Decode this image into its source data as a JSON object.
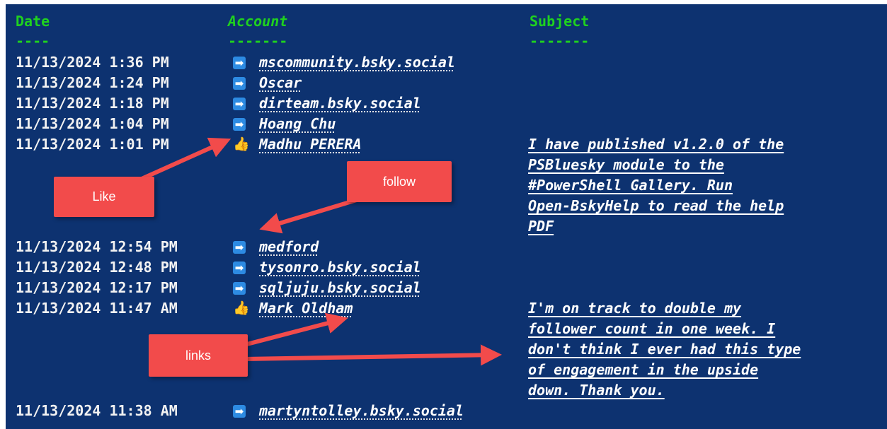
{
  "headers": {
    "date": "Date",
    "date_underline": "----",
    "account": "Account",
    "account_underline": "-------",
    "subject": "Subject",
    "subject_underline": "-------"
  },
  "rows": [
    {
      "date": "11/13/2024 1:36 PM",
      "icon": "follow-arrow-icon",
      "glyph": "➡",
      "account": "mscommunity.bsky.social"
    },
    {
      "date": "11/13/2024 1:24 PM",
      "icon": "follow-arrow-icon",
      "glyph": "➡",
      "account": "Oscar"
    },
    {
      "date": "11/13/2024 1:18 PM",
      "icon": "follow-arrow-icon",
      "glyph": "➡",
      "account": "dirteam.bsky.social"
    },
    {
      "date": "11/13/2024 1:04 PM",
      "icon": "follow-arrow-icon",
      "glyph": "➡",
      "account": "Hoang Chu"
    },
    {
      "date": "11/13/2024 1:01 PM",
      "icon": "thumbs-up-icon",
      "glyph": "👍",
      "account": "Madhu PERERA",
      "subject": [
        "I have published v1.2.0 of the",
        "PSBluesky module to the",
        "#PowerShell Gallery. Run",
        "Open-BskyHelp to read the help",
        "PDF"
      ]
    },
    {
      "date": "11/13/2024 12:54 PM",
      "icon": "follow-arrow-icon",
      "glyph": "➡",
      "account": "medford"
    },
    {
      "date": "11/13/2024 12:48 PM",
      "icon": "follow-arrow-icon",
      "glyph": "➡",
      "account": "tysonro.bsky.social"
    },
    {
      "date": "11/13/2024 12:17 PM",
      "icon": "follow-arrow-icon",
      "glyph": "➡",
      "account": "sqljuju.bsky.social"
    },
    {
      "date": "11/13/2024 11:47 AM",
      "icon": "thumbs-up-icon",
      "glyph": "👍",
      "account": "Mark Oldham",
      "subject": [
        "I'm on track to double my",
        "follower count in one week. I",
        "don't think I ever had this type",
        "of engagement in the upside",
        "down. Thank you."
      ]
    },
    {
      "date": "11/13/2024 11:38 AM",
      "icon": "follow-arrow-icon",
      "glyph": "➡",
      "account": "martyntolley.bsky.social"
    }
  ],
  "callouts": {
    "like": "Like",
    "follow": "follow",
    "links": "links"
  },
  "colors": {
    "background": "#0d3270",
    "header": "#1fd11f",
    "callout": "#f24b4b"
  }
}
